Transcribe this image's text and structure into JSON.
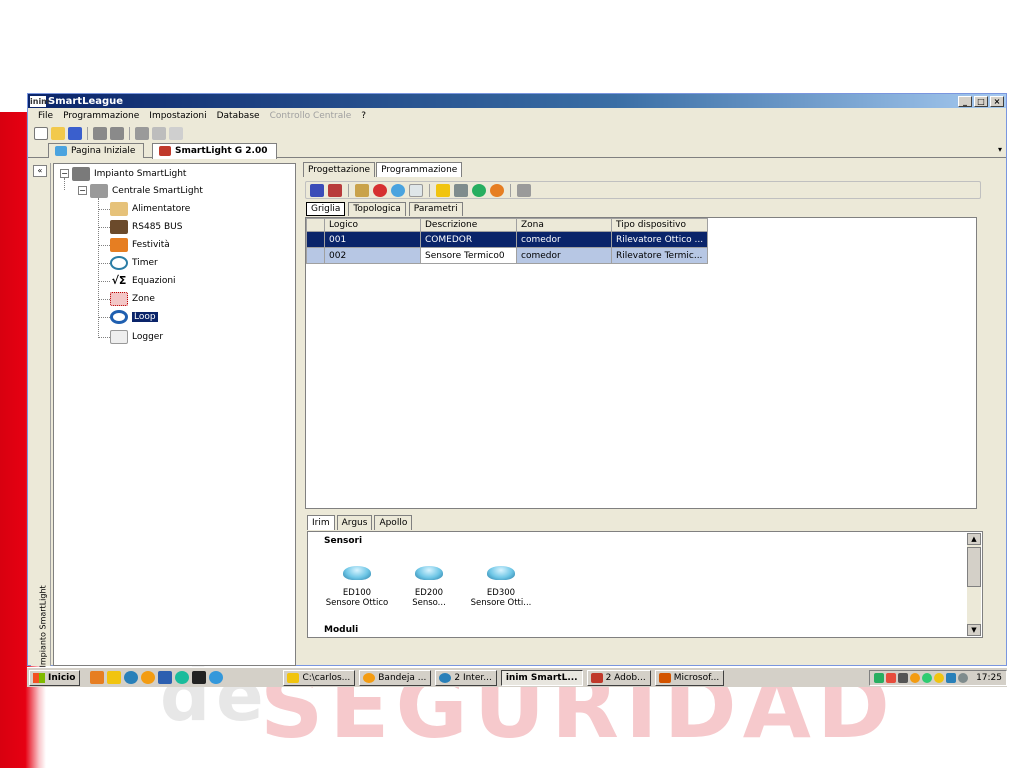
{
  "watermark": {
    "text1": "de",
    "text2": "SEGURIDAD"
  },
  "window": {
    "app_icon": "inim",
    "title": "SmartLeague",
    "controls": {
      "minimize": "_",
      "maximize": "□",
      "close": "×"
    }
  },
  "menu": {
    "file": "File",
    "programmazione": "Programmazione",
    "impostazioni": "Impostazioni",
    "database": "Database",
    "controllo": "Controllo Centrale",
    "help": "?"
  },
  "doc_tabs": {
    "home": "Pagina Iniziale",
    "smartlight": "SmartLight G 2.00",
    "dropdown": "▾"
  },
  "side": {
    "collapse": "«",
    "vertical_label": "Impianto SmartLight"
  },
  "tree": {
    "root": "Impianto SmartLight",
    "central": "Centrale SmartLight",
    "items": [
      "Alimentatore",
      "RS485 BUS",
      "Festività",
      "Timer",
      "Equazioni",
      "Zone",
      "Loop",
      "Logger"
    ],
    "selected_index": 6
  },
  "right_tabs": {
    "progettazione": "Progettazione",
    "programmazione": "Programmazione"
  },
  "sub_tabs": {
    "griglia": "Griglia",
    "topologica": "Topologica",
    "parametri": "Parametri"
  },
  "grid": {
    "columns": [
      "Logico",
      "Descrizione",
      "Zona",
      "Tipo dispositivo"
    ],
    "rows": [
      [
        "001",
        "COMEDOR",
        "comedor",
        "Rilevatore Ottico ..."
      ],
      [
        "002",
        "Sensore Termico0",
        "comedor",
        "Rilevatore Termic..."
      ]
    ]
  },
  "library": {
    "tabs": [
      "Irim",
      "Argus",
      "Apollo"
    ],
    "section_sensori": "Sensori",
    "section_moduli": "Moduli",
    "devices": [
      {
        "code": "ED100",
        "desc": "Sensore Ottico"
      },
      {
        "code": "ED200",
        "desc": "Senso..."
      },
      {
        "code": "ED300",
        "desc": "Sensore Otti..."
      }
    ]
  },
  "taskbar": {
    "start": "Inicio",
    "buttons": [
      "C:\\carlos...",
      "Bandeja ...",
      "2 Inter...",
      "inim SmartL...",
      "2 Adob...",
      "Microsof..."
    ],
    "tray_clock": "17:25"
  }
}
